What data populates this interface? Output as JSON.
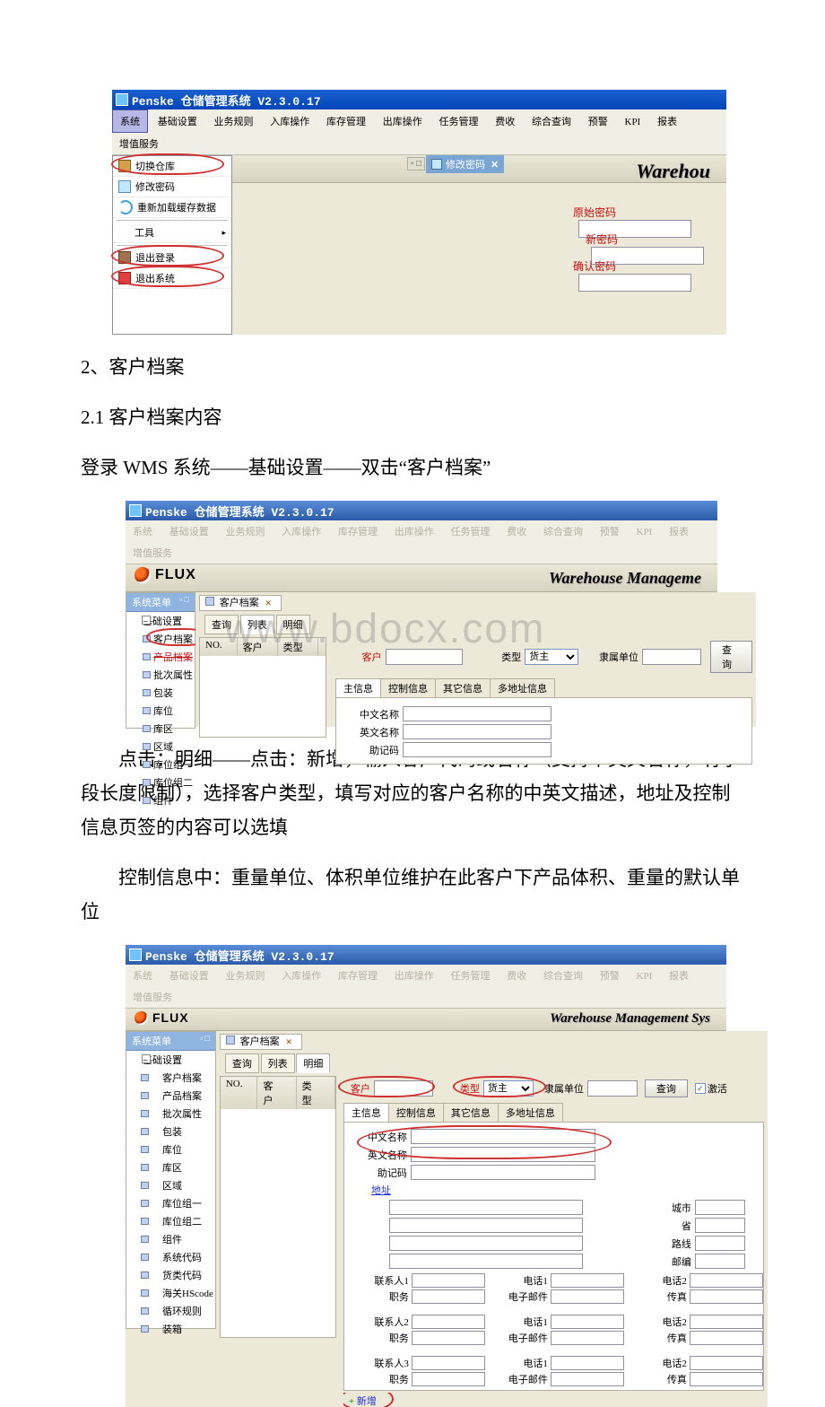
{
  "shot1": {
    "title": "Penske  仓储管理系统  V2.3.0.17",
    "menus": [
      "系统",
      "基础设置",
      "业务规则",
      "入库操作",
      "库存管理",
      "出库操作",
      "任务管理",
      "费收",
      "综合查询",
      "预警",
      "KPI",
      "报表",
      "增值服务"
    ],
    "dropdown": {
      "switch": "切换仓库",
      "changepw": "修改密码",
      "reload": "重新加载缓存数据",
      "tools": "工具",
      "logout": "退出登录",
      "exit": "退出系统"
    },
    "pwtab": "修改密码",
    "form": {
      "orig": "原始密码",
      "new": "新密码",
      "confirm": "确认密码"
    },
    "brand": "Warehou"
  },
  "doc": {
    "h1": "2、客户档案",
    "h2": "2.1 客户档案内容",
    "p1": "登录 WMS 系统——基础设置——双击“客户档案”",
    "p2": "点击：明细——点击：新增，输入客户代码或名称（支持中英文名称，有字段长度限制），选择客户类型，填写对应的客户名称的中英文描述，地址及控制信息页签的内容可以选填",
    "p3": "控制信息中：重量单位、体积单位维护在此客户下产品体积、重量的默认单位"
  },
  "shot2": {
    "title": "Penske  仓储管理系统  V2.3.0.17",
    "menus": [
      "系统",
      "基础设置",
      "业务规则",
      "入库操作",
      "库存管理",
      "出库操作",
      "任务管理",
      "费收",
      "综合查询",
      "预警",
      "KPI",
      "报表",
      "增值服务"
    ],
    "logo": "FLUX",
    "brand": "Warehouse Manageme",
    "sysmenu": "系统菜单",
    "tree": {
      "root": "基础设置",
      "items": [
        "客户档案",
        "产品档案",
        "批次属性",
        "包装",
        "库位",
        "库区",
        "区域",
        "库位组一",
        "库位组二",
        "组件"
      ]
    },
    "tab": "客户档案",
    "subtabs": [
      "查询",
      "列表",
      "明细"
    ],
    "grid": {
      "no": "NO.",
      "cust": "客户",
      "type": "类型"
    },
    "search": {
      "cust": "客户",
      "type": "类型",
      "typeval": "货主",
      "unit": "隶属单位",
      "btn": "查询"
    },
    "infotabs": [
      "主信息",
      "控制信息",
      "其它信息",
      "多地址信息"
    ],
    "names": {
      "cn": "中文名称",
      "en": "英文名称",
      "code": "助记码"
    },
    "watermark": "www.bdocx.com"
  },
  "shot3": {
    "title": "Penske  仓储管理系统  V2.3.0.17",
    "menus": [
      "系统",
      "基础设置",
      "业务规则",
      "入库操作",
      "库存管理",
      "出库操作",
      "任务管理",
      "费收",
      "综合查询",
      "预警",
      "KPI",
      "报表",
      "增值服务"
    ],
    "logo": "FLUX",
    "brand": "Warehouse Management Sys",
    "sysmenu": "系统菜单",
    "tree": {
      "root": "基础设置",
      "items": [
        "客户档案",
        "产品档案",
        "批次属性",
        "包装",
        "库位",
        "库区",
        "区域",
        "库位组一",
        "库位组二",
        "组件",
        "系统代码",
        "货类代码",
        "海关HScode",
        "循环规则",
        "装箱"
      ]
    },
    "tab": "客户档案",
    "subtabs": [
      "查询",
      "列表",
      "明细"
    ],
    "grid": {
      "no": "NO.",
      "cust": "客户",
      "type": "类型"
    },
    "search": {
      "cust": "客户",
      "type": "类型",
      "typeval": "货主",
      "unit": "隶属单位",
      "btn": "查询",
      "active": "激活"
    },
    "infotabs": [
      "主信息",
      "控制信息",
      "其它信息",
      "多地址信息"
    ],
    "names": {
      "cn": "中文名称",
      "en": "英文名称",
      "code": "助记码"
    },
    "addr": "地址",
    "addrside": {
      "city": "城市",
      "prov": "省",
      "route": "路线",
      "zip": "邮编"
    },
    "contacts": {
      "c1": "联系人1",
      "c2": "联系人2",
      "c3": "联系人3",
      "job": "职务",
      "tel1": "电话1",
      "tel2": "电话2",
      "mail": "电子邮件",
      "fax": "传真"
    },
    "bottom": {
      "new": "新增"
    }
  }
}
